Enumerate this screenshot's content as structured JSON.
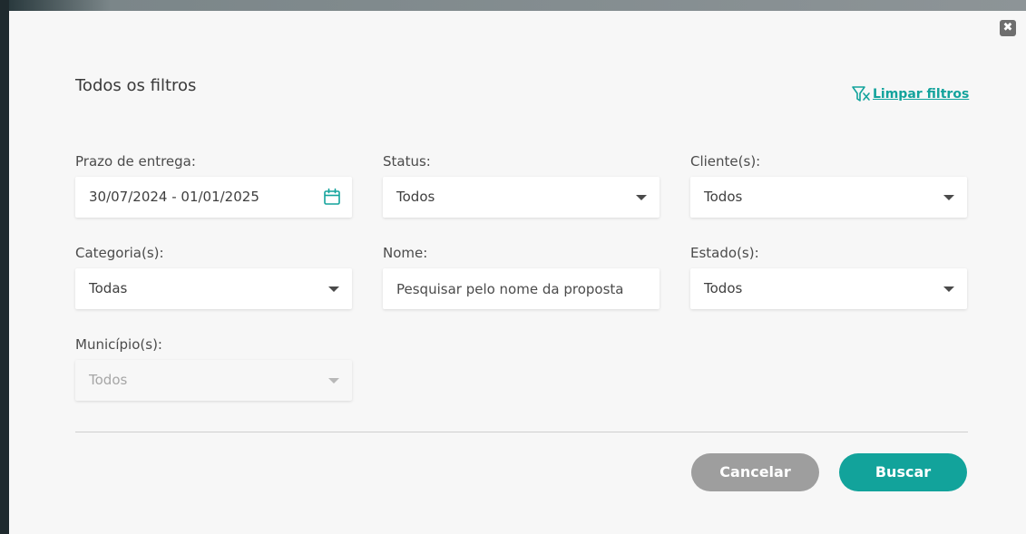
{
  "modal": {
    "title": "Todos os filtros",
    "clear_filters_label": "Limpar filtros",
    "close_glyph": "✖"
  },
  "fields": {
    "delivery_deadline": {
      "label": "Prazo de entrega:",
      "value": "30/07/2024 - 01/01/2025"
    },
    "status": {
      "label": "Status:",
      "value": "Todos"
    },
    "clients": {
      "label": "Cliente(s):",
      "value": "Todos"
    },
    "categories": {
      "label": "Categoria(s):",
      "value": "Todas"
    },
    "name": {
      "label": "Nome:",
      "value": "",
      "placeholder": "Pesquisar pelo nome da proposta"
    },
    "states": {
      "label": "Estado(s):",
      "value": "Todos"
    },
    "municipalities": {
      "label": "Município(s):",
      "value": "Todos",
      "disabled": true
    }
  },
  "actions": {
    "cancel_label": "Cancelar",
    "search_label": "Buscar"
  },
  "colors": {
    "accent": "#12a39b",
    "cancel": "#9e9e9e"
  },
  "icons": {
    "clear": "filter-clear-icon",
    "calendar": "calendar-icon",
    "close": "close-icon",
    "dropdown": "caret-down-icon"
  }
}
